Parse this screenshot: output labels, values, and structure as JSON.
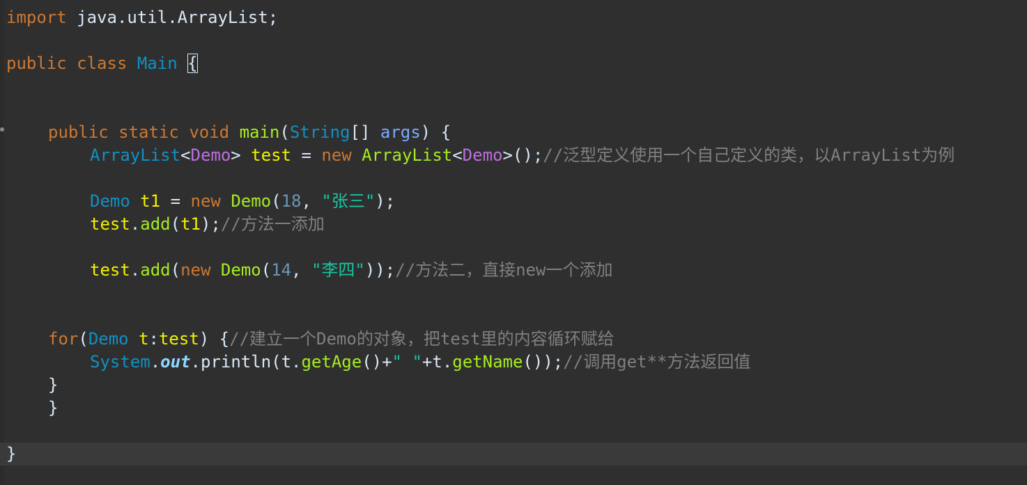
{
  "lines": {
    "l1": {
      "kw_import": "import",
      "rest": " java.util.ArrayList;"
    },
    "l2": {
      "kw_public": "public",
      "kw_class": "class",
      "name": "Main",
      "brace": "{"
    },
    "l3": {
      "kw_public": "public",
      "kw_static": "static",
      "kw_void": "void",
      "method": "main",
      "open": "(",
      "type": "String",
      "arr": "[]",
      "param": "args",
      "close": ") {"
    },
    "l4": {
      "type": "ArrayList",
      "lt": "<",
      "generic": "Demo",
      "gt": ">",
      "var": "test",
      "eq": " = ",
      "kw_new": "new",
      "ctor": "ArrayList",
      "lt2": "<",
      "generic2": "Demo",
      "gt2": ">",
      "end": "();",
      "comment": "//泛型定义使用一个自己定义的类，以ArrayList为例"
    },
    "l5": {
      "type": "Demo",
      "var": "t1",
      "eq": " = ",
      "kw_new": "new",
      "ctor": "Demo",
      "open": "(",
      "num": "18",
      "comma": ", ",
      "str": "\"张三\"",
      "end": ");"
    },
    "l6": {
      "var": "test",
      "dot": ".",
      "method": "add",
      "open": "(",
      "arg": "t1",
      "end": ");",
      "comment": "//方法一添加"
    },
    "l7": {
      "var": "test",
      "dot": ".",
      "method": "add",
      "open": "(",
      "kw_new": "new",
      "ctor": "Demo",
      "open2": "(",
      "num": "14",
      "comma": ", ",
      "str": "\"李四\"",
      "end": "));",
      "comment": "//方法二，直接new一个添加"
    },
    "l8": {
      "kw_for": "for",
      "open": "(",
      "type": "Demo",
      "var": "t",
      "colon": ":",
      "var2": "test",
      "close": ") {",
      "comment": "//建立一个Demo的对象，把test里的内容循环赋给"
    },
    "l9": {
      "cls": "System",
      "dot": ".",
      "field": "out",
      "dot2": ".",
      "method": "println",
      "open": "(",
      "obj": "t",
      "dot3": ".",
      "m1": "getAge",
      "p1": "()+",
      "str": "\" \"",
      "plus": "+",
      "obj2": "t",
      "dot4": ".",
      "m2": "getName",
      "end": "());",
      "comment": "//调用get**方法返回值"
    },
    "l10": {
      "brace": "}"
    },
    "l11": {
      "brace": "}"
    },
    "l12": {
      "brace": "}"
    }
  }
}
